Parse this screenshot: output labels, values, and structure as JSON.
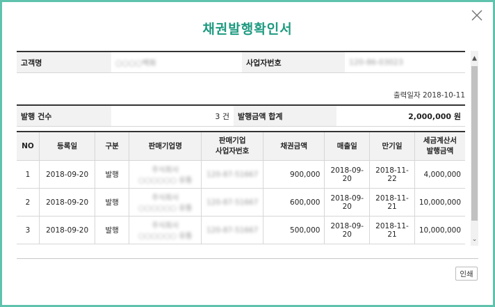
{
  "dialog": {
    "title": "채권발행확인서",
    "close_icon": "close-icon",
    "print_label": "인쇄"
  },
  "customer": {
    "name_label": "고객명",
    "name_value": "○○○○백화",
    "bizno_label": "사업자번호",
    "bizno_value": "120-86-03023"
  },
  "print_date": "출력일자 2018-10-11",
  "summary": {
    "count_label": "발행 건수",
    "count_value": "3 건",
    "amount_label": "발행금액 합계",
    "amount_value": "2,000,000 원"
  },
  "table": {
    "headers": [
      "NO",
      "등록일",
      "구분",
      "판매기업명",
      "판매기업\n사업자번호",
      "채권금액",
      "매출일",
      "만기일",
      "세금계산서\n발행금액"
    ],
    "rows": [
      {
        "no": "1",
        "reg": "2018-09-20",
        "type": "발행",
        "company": "주식회사 ○○○○○○ 유통",
        "bizno": "120-87-51667",
        "amount": "900,000",
        "sale": "2018-09-20",
        "due": "2018-11-22",
        "tax": "4,000,000"
      },
      {
        "no": "2",
        "reg": "2018-09-20",
        "type": "발행",
        "company": "주식회사 ○○○○○○ 유통",
        "bizno": "120-87-51667",
        "amount": "600,000",
        "sale": "2018-09-20",
        "due": "2018-11-21",
        "tax": "10,000,000"
      },
      {
        "no": "3",
        "reg": "2018-09-20",
        "type": "발행",
        "company": "주식회사 ○○○○○○ 유통",
        "bizno": "120-87-51667",
        "amount": "500,000",
        "sale": "2018-09-20",
        "due": "2018-11-21",
        "tax": "10,000,000"
      }
    ]
  },
  "scrollbar": {
    "up_icon": "chevron-up-icon",
    "down_icon": "chevron-down-icon"
  },
  "colors": {
    "accent": "#1e9a80",
    "border": "#5fc2ac"
  }
}
